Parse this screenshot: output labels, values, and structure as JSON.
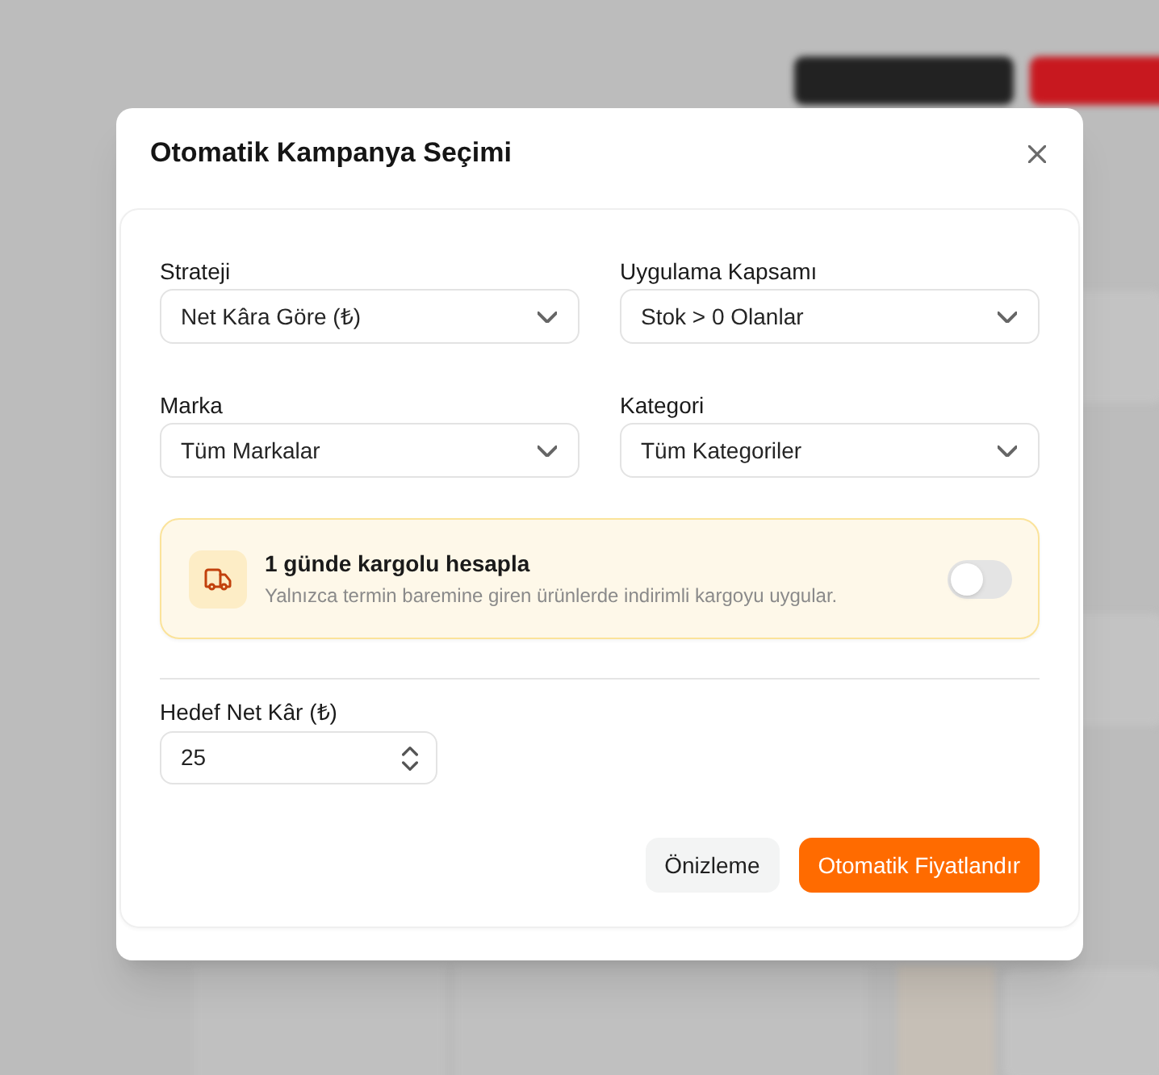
{
  "dialog": {
    "title": "Otomatik Kampanya Seçimi"
  },
  "selects": [
    {
      "label": "Strateji",
      "value": "Net Kâra Göre (₺)"
    },
    {
      "label": "Uygulama Kapsamı",
      "value": "Stok > 0 Olanlar"
    },
    {
      "label": "Marka",
      "value": "Tüm Markalar"
    },
    {
      "label": "Kategori",
      "value": "Tüm Kategoriler"
    }
  ],
  "option": {
    "title": "1 günde kargolu hesapla",
    "description": "Yalnızca termin baremine giren ürünlerde indirimli kargoyu uygular.",
    "on": false
  },
  "target": {
    "label": "Hedef Net Kâr (₺)",
    "value": "25"
  },
  "buttons": [
    {
      "label": "Önizleme",
      "kind": "secondary"
    },
    {
      "label": "Otomatik Fiyatlandır",
      "kind": "primary"
    }
  ]
}
